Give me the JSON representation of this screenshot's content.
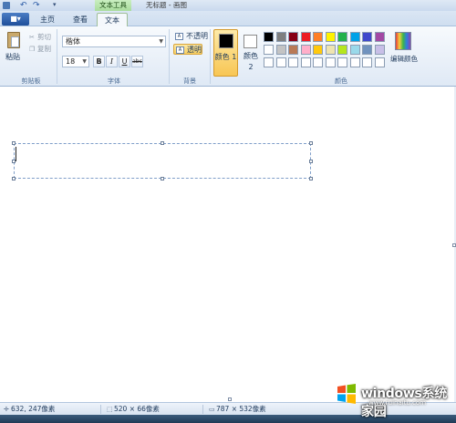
{
  "titlebar": {
    "context_tab_label": "文本工具",
    "window_title": "无标题 - 画图"
  },
  "tabs": {
    "app_menu": "■▾",
    "home": "主页",
    "view": "查看",
    "text": "文本"
  },
  "clipboard": {
    "paste_label": "粘贴",
    "cut_label": "剪切",
    "copy_label": "复制",
    "group_label": "剪贴板"
  },
  "font": {
    "family_value": "楷体",
    "size_value": "18",
    "bold_label": "B",
    "italic_label": "I",
    "underline_label": "U",
    "strike_label": "abc",
    "group_label": "字体"
  },
  "background": {
    "opaque_label": "不透明",
    "transparent_label": "透明",
    "group_label": "背景"
  },
  "colors": {
    "color1_label": "颜色 1",
    "color2_label": "颜色 2",
    "edit_colors_label": "编辑颜色",
    "group_label": "颜色",
    "color1_value": "#000000",
    "color2_value": "#ffffff",
    "palette_row1": [
      "#000000",
      "#7f7f7f",
      "#880015",
      "#ed1c24",
      "#ff7f27",
      "#fff200",
      "#22b14c",
      "#00a2e8",
      "#3f48cc",
      "#a349a4"
    ],
    "palette_row2": [
      "#ffffff",
      "#c3c3c3",
      "#b97a57",
      "#ffaec9",
      "#ffc90e",
      "#efe4b0",
      "#b5e61d",
      "#99d9ea",
      "#7092be",
      "#c8bfe7"
    ],
    "palette_row3": [
      "#ffffff",
      "#ffffff",
      "#ffffff",
      "#ffffff",
      "#ffffff",
      "#ffffff",
      "#ffffff",
      "#ffffff",
      "#ffffff",
      "#ffffff"
    ]
  },
  "status": {
    "cursor_pos": "632, 247像素",
    "selection_size": "520 × 66像素",
    "image_size": "787 × 532像素"
  },
  "watermark": {
    "brand": "windows系统家园",
    "url": "www.ruinaitu.com",
    "cn": "系统家园"
  }
}
